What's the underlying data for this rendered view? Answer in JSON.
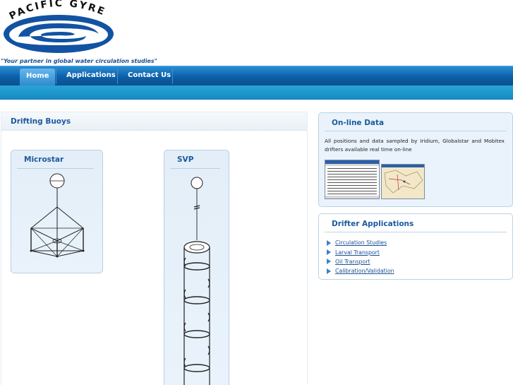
{
  "brand": {
    "logo_text": "PACIFIC GYRE",
    "tagline": "\"Your partner in global water circulation studies\"",
    "color": "#1a4f93"
  },
  "nav": {
    "items": [
      {
        "label": "Home",
        "active": true
      },
      {
        "label": "Applications",
        "active": false
      },
      {
        "label": "Contact Us",
        "active": false
      }
    ]
  },
  "main": {
    "title": "Drifting Buoys",
    "cards": [
      {
        "title": "Microstar",
        "icon": "microstar-drifter-diagram"
      },
      {
        "title": "SVP",
        "icon": "svp-drifter-diagram"
      }
    ]
  },
  "online": {
    "title": "On-line Data",
    "text": "All positions and data sampled by Iridium, Globalstar and Mobitex drifters available real time on-line",
    "thumbs": [
      "data-table-screenshot-icon",
      "map-screenshot-icon"
    ]
  },
  "applications": {
    "title": "Drifter Applications",
    "items": [
      {
        "label": "Circulation Studies"
      },
      {
        "label": "Larval Transport"
      },
      {
        "label": "Oil Transport"
      },
      {
        "label": "Calibration/Validation"
      }
    ]
  },
  "colors": {
    "nav_dark": "#0c5fa8",
    "nav_light": "#2a8ed3",
    "accent_text": "#1a5a9e",
    "panel_bg": "#eaf3fb"
  }
}
